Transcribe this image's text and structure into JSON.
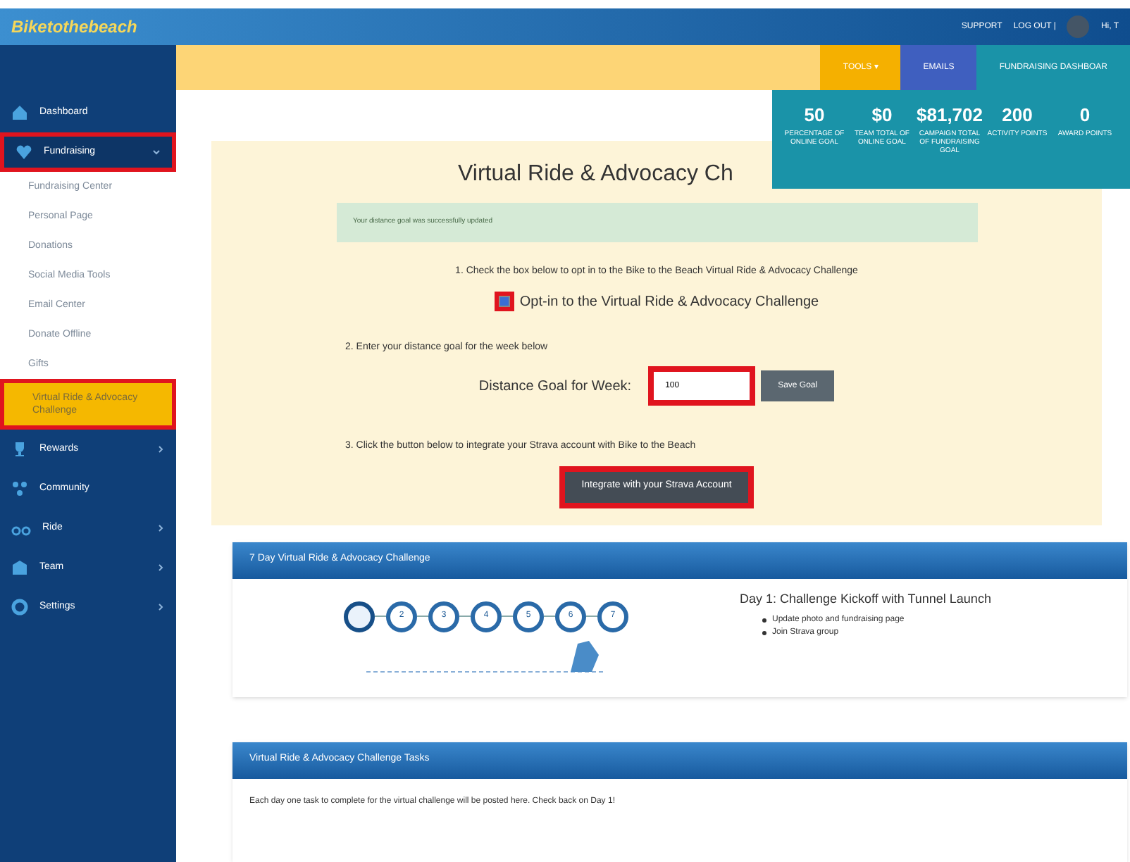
{
  "header": {
    "logo": "Biketothebeach",
    "links": [
      "SUPPORT",
      "LOG OUT |"
    ],
    "user": "Hi, T"
  },
  "toolbar": [
    {
      "label": "TOOLS ▾",
      "kind": "tools"
    },
    {
      "label": "EMAILS",
      "kind": "emails"
    },
    {
      "label": "FUNDRAISING DASHBOAR",
      "kind": "dashboard"
    }
  ],
  "stats": [
    {
      "value": "50",
      "label": "PERCENTAGE OF ONLINE GOAL"
    },
    {
      "value": "$0",
      "label": "TEAM TOTAL OF ONLINE GOAL"
    },
    {
      "value": "$81,702",
      "label": "CAMPAIGN TOTAL OF FUNDRAISING GOAL"
    },
    {
      "value": "200",
      "label": "ACTIVITY POINTS"
    },
    {
      "value": "0",
      "label": "AWARD POINTS"
    }
  ],
  "sidebar": {
    "items": [
      {
        "label": "Dashboard",
        "kind": "home",
        "selected": false,
        "highlighted": false
      },
      {
        "label": "Fundraising",
        "kind": "heart",
        "selected": true,
        "highlighted": true,
        "expanded": true,
        "children": [
          {
            "label": "Fundraising Center",
            "selected": false,
            "highlighted": false
          },
          {
            "label": "Personal Page",
            "selected": false,
            "highlighted": false
          },
          {
            "label": "Donations",
            "selected": false,
            "highlighted": false
          },
          {
            "label": "Social Media Tools",
            "selected": false,
            "highlighted": false
          },
          {
            "label": "Email Center",
            "selected": false,
            "highlighted": false
          },
          {
            "label": "Donate Offline",
            "selected": false,
            "highlighted": false
          },
          {
            "label": "Gifts",
            "selected": false,
            "highlighted": false
          },
          {
            "label": "Virtual Ride & Advocacy Challenge",
            "selected": true,
            "highlighted": true
          }
        ]
      },
      {
        "label": "Rewards",
        "kind": "trophy",
        "selected": false,
        "highlighted": false,
        "expanded": false
      },
      {
        "label": "Community",
        "kind": "network",
        "selected": false,
        "highlighted": false
      },
      {
        "label": "Ride",
        "kind": "bike",
        "selected": false,
        "highlighted": false,
        "expanded": false
      },
      {
        "label": "Team",
        "kind": "team",
        "selected": false,
        "highlighted": false,
        "expanded": false
      },
      {
        "label": "Settings",
        "kind": "gear",
        "selected": false,
        "highlighted": false,
        "expanded": false
      }
    ]
  },
  "challenge": {
    "title": "Virtual Ride & Advocacy Ch",
    "alert": "Your distance goal was successfully updated",
    "step1": "1. Check the box below to opt in to the Bike to the Beach Virtual Ride & Advocacy Challenge",
    "optin": {
      "label": "Opt-in to the Virtual Ride & Advocacy Challenge",
      "checked": true,
      "highlighted": true
    },
    "step2": "2. Enter your distance goal for the week below",
    "goal": {
      "label": "Distance Goal for Week:",
      "value": "100",
      "highlighted": true,
      "button": "Save Goal"
    },
    "step3": "3. Click the button below to integrate your Strava account with Bike to the Beach",
    "integrate": {
      "label": "Integrate with your Strava Account",
      "highlighted": true
    }
  },
  "week_panel": {
    "title": "7 Day Virtual Ride & Advocacy Challenge",
    "steps": [
      {
        "selected": true
      },
      {
        "label": "2",
        "selected": false
      },
      {
        "label": "3",
        "selected": false
      },
      {
        "label": "4",
        "selected": false
      },
      {
        "label": "5",
        "selected": false
      },
      {
        "label": "6",
        "selected": false
      },
      {
        "label": "7",
        "selected": false
      }
    ],
    "day_title": "Day 1: Challenge Kickoff with Tunnel Launch",
    "tasks": [
      "Update photo and fundraising page",
      "Join Strava group"
    ]
  },
  "tasks_panel": {
    "title": "Virtual Ride & Advocacy Challenge Tasks",
    "text": "Each day one task to complete for the virtual challenge will be posted here. Check back on Day 1!"
  }
}
